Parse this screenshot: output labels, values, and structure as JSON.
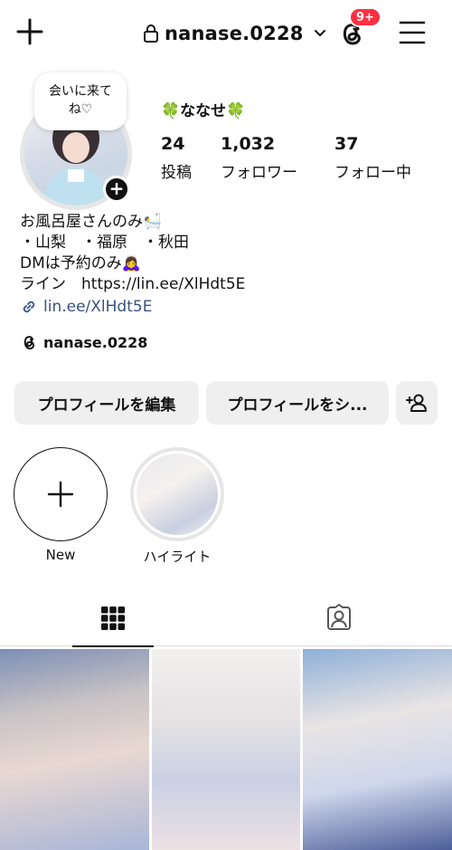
{
  "header": {
    "username": "nanase.0228",
    "notification_badge": "9+",
    "icons": [
      "plus-icon",
      "lock-icon",
      "chevron-down-icon",
      "threads-icon",
      "menu-icon"
    ],
    "badge_color": "#ff3040"
  },
  "profile": {
    "note": "会いに来て\nね♡",
    "display_name": "🍀ななせ🍀",
    "stats": [
      {
        "value": "24",
        "label": "投稿"
      },
      {
        "value": "1,032",
        "label": "フォロワー"
      },
      {
        "value": "37",
        "label": "フォロー中"
      }
    ],
    "bio_lines": [
      "お風呂屋さんのみ🛀",
      "・山梨　・福原　・秋田",
      "DMは予約のみ🙇‍♀️",
      "ライン　https://lin.ee/XlHdt5E"
    ],
    "link": "lin.ee/XlHdt5E",
    "threads_handle": "nanase.0228",
    "link_color": "#385185"
  },
  "buttons": {
    "edit": "プロフィールを編集",
    "share": "プロフィールをシ..."
  },
  "highlights": [
    {
      "label": "New"
    },
    {
      "label": "ハイライト"
    }
  ],
  "tabs": [
    {
      "icon": "grid-icon"
    },
    {
      "icon": "tagged-icon"
    }
  ]
}
